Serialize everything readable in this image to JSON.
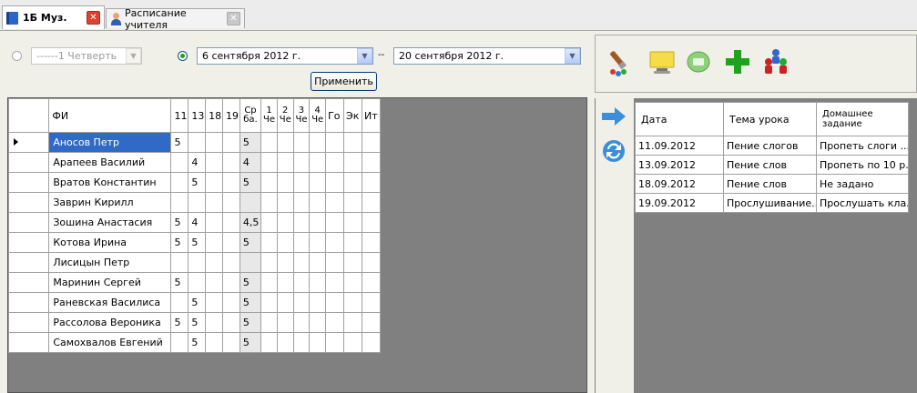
{
  "tabs": [
    {
      "label": "1Б Муз.",
      "active": true
    },
    {
      "label": "Расписание учителя",
      "active": false
    }
  ],
  "controls": {
    "quarter_value": "------1 Четверть",
    "date_from": "6 сентября 2012 г.",
    "date_separator": "--",
    "date_to": "20 сентября 2012 г.",
    "apply_label": "Применить"
  },
  "grades": {
    "name_header": "ФИ",
    "day_headers": [
      "11",
      "13",
      "18",
      "19"
    ],
    "extra_headers": [
      {
        "top": "Ср",
        "bottom": "ба."
      },
      {
        "top": "1",
        "bottom": "Че"
      },
      {
        "top": "2",
        "bottom": "Че"
      },
      {
        "top": "3",
        "bottom": "Че"
      },
      {
        "top": "4",
        "bottom": "Че"
      }
    ],
    "tail_headers": [
      "Го",
      "Эк",
      "Ит"
    ],
    "rows": [
      {
        "name": "Аносов Петр",
        "d11": "5",
        "d13": "",
        "d18": "",
        "d19": "",
        "avg": "5",
        "current": true
      },
      {
        "name": "Арапеев Василий",
        "d11": "",
        "d13": "4",
        "d18": "",
        "d19": "",
        "avg": "4"
      },
      {
        "name": "Вратов Константин",
        "d11": "",
        "d13": "5",
        "d18": "",
        "d19": "",
        "avg": "5"
      },
      {
        "name": "Заврин Кирилл",
        "d11": "",
        "d13": "",
        "d18": "",
        "d19": "",
        "avg": ""
      },
      {
        "name": "Зошина Анастасия",
        "d11": "5",
        "d13": "4",
        "d18": "",
        "d19": "",
        "avg": "4,5"
      },
      {
        "name": "Котова Ирина",
        "d11": "5",
        "d13": "5",
        "d18": "",
        "d19": "",
        "avg": "5"
      },
      {
        "name": "Лисицын Петр",
        "d11": "",
        "d13": "",
        "d18": "",
        "d19": "",
        "avg": ""
      },
      {
        "name": "Маринин Сергей",
        "d11": "5",
        "d13": "",
        "d18": "",
        "d19": "",
        "avg": "5"
      },
      {
        "name": "Раневская Василиса",
        "d11": "",
        "d13": "5",
        "d18": "",
        "d19": "",
        "avg": "5"
      },
      {
        "name": "Рассолова Вероника",
        "d11": "5",
        "d13": "5",
        "d18": "",
        "d19": "",
        "avg": "5"
      },
      {
        "name": "Самохвалов Евгений",
        "d11": "",
        "d13": "5",
        "d18": "",
        "d19": "",
        "avg": "5"
      }
    ]
  },
  "lessons": {
    "headers": [
      "Дата",
      "Тема урока",
      "Домашнее задание"
    ],
    "rows": [
      {
        "date": "11.09.2012",
        "topic": "Пение слогов",
        "homework": "Пропеть слоги ..."
      },
      {
        "date": "13.09.2012",
        "topic": "Пение слов",
        "homework": "Пропеть по 10 р..."
      },
      {
        "date": "18.09.2012",
        "topic": "Пение слов",
        "homework": "Не задано"
      },
      {
        "date": "19.09.2012",
        "topic": "Прослушивание...",
        "homework": "Прослушать кла..."
      }
    ]
  },
  "toolbar_icons": [
    "paint-brush-icon",
    "monitor-note-icon",
    "print-disc-icon",
    "add-plus-icon",
    "people-group-icon"
  ],
  "side_icons": [
    "arrow-right-icon",
    "refresh-icon"
  ],
  "colors": {
    "selection": "#3169c6",
    "grid_background": "#808080",
    "close_tab_active": "#d9432f"
  }
}
